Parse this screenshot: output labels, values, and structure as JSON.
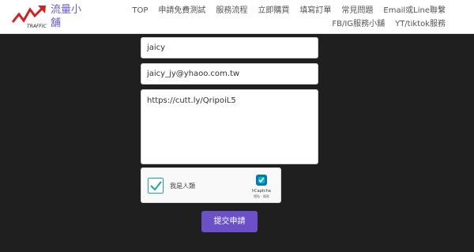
{
  "brand": {
    "name": "流量小舖",
    "logo_text": "TRAFFIC",
    "logo_icon": "rising-arrow-logo"
  },
  "nav": {
    "row1": [
      "TOP",
      "申請免費測試",
      "服務流程",
      "立即購買",
      "填寫訂單",
      "常見問題",
      "Email或Line聯繫"
    ],
    "row2": [
      "FB/IG服務小舖",
      "YT/tiktok服務"
    ]
  },
  "form": {
    "name_value": "jaicy",
    "email_value": "jaicy_jy@yhaoo.com.tw",
    "message_value": "https://cutt.ly/QripoiL5",
    "captcha": {
      "label": "我是人類",
      "checked": true,
      "brand": "hCaptcha",
      "links": "隱私 - 條款"
    },
    "submit_label": "提交申請"
  },
  "colors": {
    "accent": "#6b50c8",
    "check": "#19a8a0",
    "background": "#1f1f1f"
  }
}
